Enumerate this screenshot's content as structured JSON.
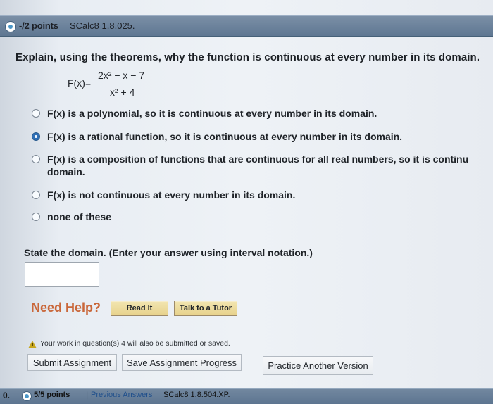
{
  "header": {
    "points": "-/2 points",
    "problem_id": "SCalc8 1.8.025."
  },
  "question": {
    "prompt": "Explain, using the theorems, why the function is continuous at every number in its domain.",
    "function_label": "F(x)",
    "equals": "=",
    "numerator": "2x² − x − 7",
    "denominator": "x² + 4"
  },
  "options": [
    {
      "text": "F(x) is a polynomial, so it is continuous at every number in its domain.",
      "selected": false
    },
    {
      "text": "F(x) is a rational function, so it is continuous at every number in its domain.",
      "selected": true
    },
    {
      "text_line_1": "F(x) is a composition of functions that are continuous for all real numbers, so it is continu",
      "text_line_2": "domain.",
      "selected": false
    },
    {
      "text": "F(x) is not continuous at every number in its domain.",
      "selected": false
    },
    {
      "text": "none of these",
      "selected": false
    }
  ],
  "domain_section": {
    "prompt": "State the domain. (Enter your answer using interval notation.)",
    "answer_value": ""
  },
  "help": {
    "label": "Need Help?",
    "read_it": "Read It",
    "talk_to_tutor": "Talk to a Tutor"
  },
  "notice": {
    "text": "Your work in question(s) 4 will also be submitted or saved."
  },
  "actions": {
    "submit": "Submit Assignment",
    "save": "Save Assignment Progress",
    "practice": "Practice Another Version"
  },
  "footer": {
    "left_number": "0.",
    "points": "5/5 points",
    "separator": "|",
    "previous_answers": "Previous Answers",
    "problem_id": "SCalc8 1.8.504.XP."
  },
  "icons": {
    "top_status": "status-indicator-icon",
    "warning": "warning-icon",
    "bottom_status": "status-indicator-icon"
  },
  "colors": {
    "need_help": "#c9673a",
    "selected_radio": "#2f6fb6",
    "header_bar": "#6d83a0",
    "help_button": "#e9d68f"
  }
}
